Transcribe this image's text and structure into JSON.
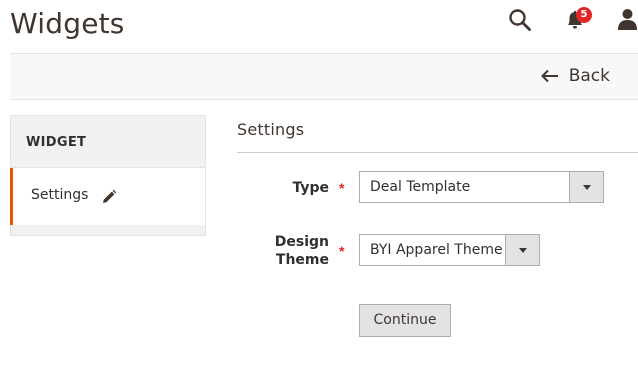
{
  "header": {
    "title": "Widgets",
    "notifications_count": "5",
    "icons": {
      "search": "search-icon",
      "notifications": "bell-icon",
      "account": "user-icon"
    }
  },
  "action_bar": {
    "back_label": "Back",
    "back_icon": "arrow-left-icon"
  },
  "side_tabs": {
    "title": "WIDGET",
    "items": [
      {
        "label": "Settings",
        "icon": "pencil-icon",
        "active": true
      }
    ]
  },
  "settings": {
    "section_title": "Settings",
    "fields": {
      "type": {
        "label": "Type",
        "required": "*",
        "value": "Deal Template"
      },
      "design_theme": {
        "label_line1": "Design",
        "label_line2": "Theme",
        "required": "*",
        "value": "BYI Apparel Theme"
      }
    },
    "continue_label": "Continue"
  },
  "colors": {
    "accent": "#eb5202",
    "required": "#e22626",
    "badge": "#e22626"
  }
}
